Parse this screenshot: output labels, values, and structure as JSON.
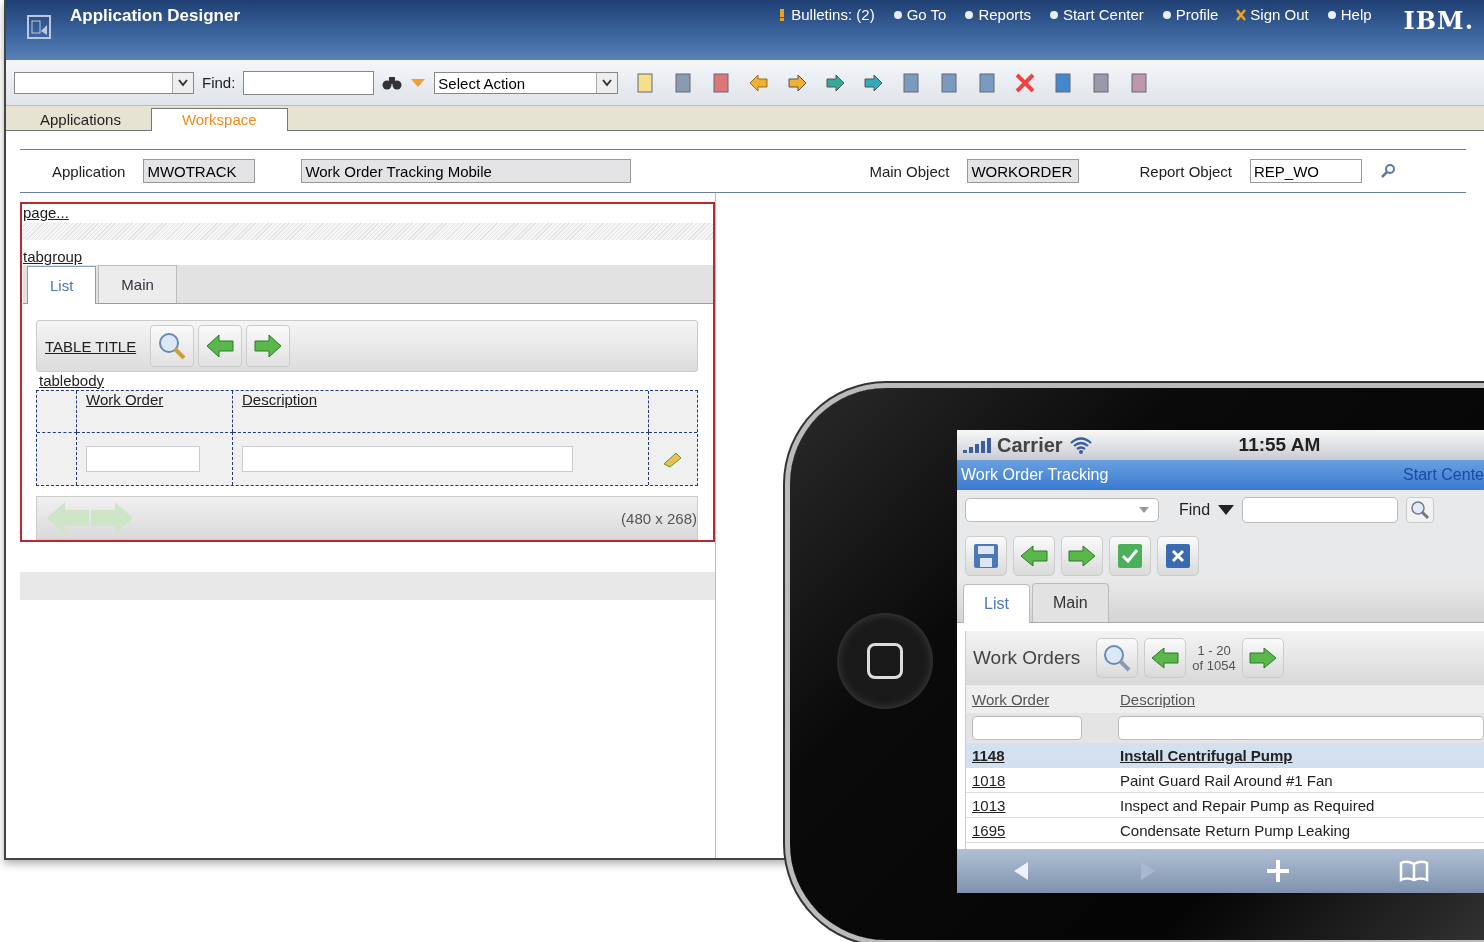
{
  "app_bar": {
    "title": "Application Designer",
    "logo": "IBM.",
    "links": [
      {
        "label": "Bulletins: (2)"
      },
      {
        "label": "Go To"
      },
      {
        "label": "Reports"
      },
      {
        "label": "Start Center"
      },
      {
        "label": "Profile"
      },
      {
        "label": "Sign Out"
      },
      {
        "label": "Help"
      }
    ]
  },
  "toolbar": {
    "find_label": "Find:",
    "action_select": "Select Action"
  },
  "module_tabs": [
    {
      "label": "Applications",
      "selected": false
    },
    {
      "label": "Workspace",
      "selected": true
    }
  ],
  "application": {
    "label": "Application",
    "value": "MWOTRACK",
    "description": "Work Order Tracking Mobile"
  },
  "main_object": {
    "label": "Main Object",
    "value": "WORKORDER"
  },
  "report_object": {
    "label": "Report Object",
    "value": "REP_WO"
  },
  "canvas": {
    "page_link": "page...",
    "tabgroup_link": "tabgroup",
    "tabs": [
      {
        "label": "List",
        "selected": true
      },
      {
        "label": "Main",
        "selected": false
      }
    ],
    "table_title": "TABLE TITLE",
    "tablebody_link": "tablebody",
    "columns": [
      "Work Order",
      "Description"
    ],
    "size": "(480 x 268)"
  },
  "phone": {
    "carrier": "Carrier",
    "time": "11:55 AM",
    "app_title": "Work Order Tracking",
    "start_center": "Start Cente",
    "find_label": "Find",
    "tabs": [
      {
        "label": "List",
        "selected": true
      },
      {
        "label": "Main",
        "selected": false
      }
    ],
    "list_title": "Work Orders",
    "range": "1 - 20",
    "total": "of 1054",
    "columns": [
      "Work Order",
      "Description"
    ],
    "rows": [
      {
        "id": "1148",
        "description": "Install Centrifugal Pump",
        "selected": true
      },
      {
        "id": "1018",
        "description": "Paint Guard Rail Around #1 Fan",
        "selected": false
      },
      {
        "id": "1013",
        "description": "Inspect and Repair Pump as Required",
        "selected": false
      },
      {
        "id": "1695",
        "description": "Condensate Return Pump Leaking",
        "selected": false
      }
    ]
  }
}
